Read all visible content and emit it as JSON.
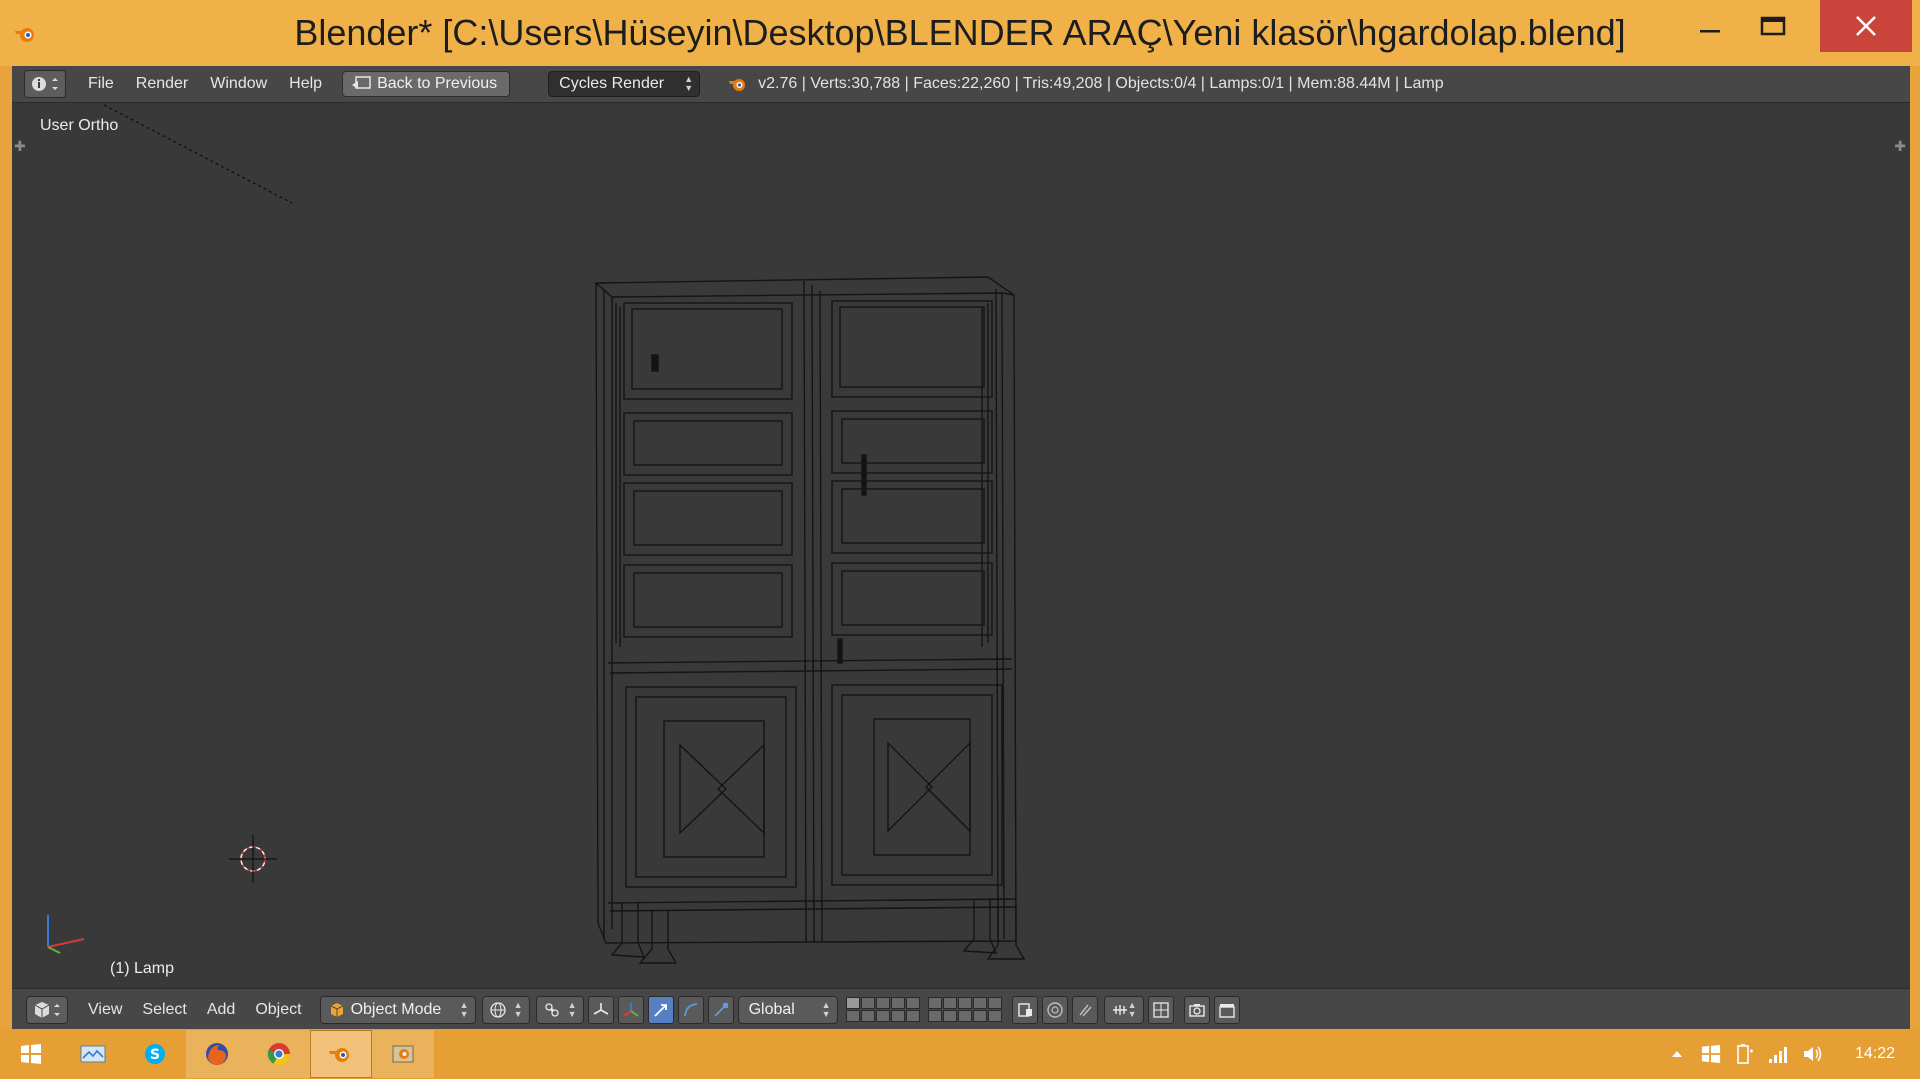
{
  "window": {
    "title": "Blender* [C:\\Users\\Hüseyin\\Desktop\\BLENDER ARAÇ\\Yeni klasör\\hgardolap.blend]",
    "icon": "blender-logo-icon"
  },
  "info_header": {
    "menu": [
      "File",
      "Render",
      "Window",
      "Help"
    ],
    "back_button": "Back to Previous",
    "render_engine": "Cycles Render",
    "stats": "v2.76 | Verts:30,788 | Faces:22,260 | Tris:49,208 | Objects:0/4 | Lamps:0/1 | Mem:88.44M | Lamp"
  },
  "viewport": {
    "view_label": "User Ortho",
    "object_label": "(1) Lamp"
  },
  "view_header": {
    "menu": [
      "View",
      "Select",
      "Add",
      "Object"
    ],
    "mode": "Object Mode",
    "orientation": "Global"
  },
  "taskbar": {
    "apps": [
      "start-icon",
      "explorer-icon",
      "skype-icon",
      "firefox-icon",
      "chrome-icon",
      "blender-icon",
      "blender-render-icon"
    ],
    "clock": "14:22"
  },
  "colors": {
    "accent": "#f0b248",
    "taskbar": "#e59f34",
    "close": "#c9443a",
    "viewport_bg": "#393939",
    "header_bg": "#474747",
    "active_button": "#5680c2"
  }
}
